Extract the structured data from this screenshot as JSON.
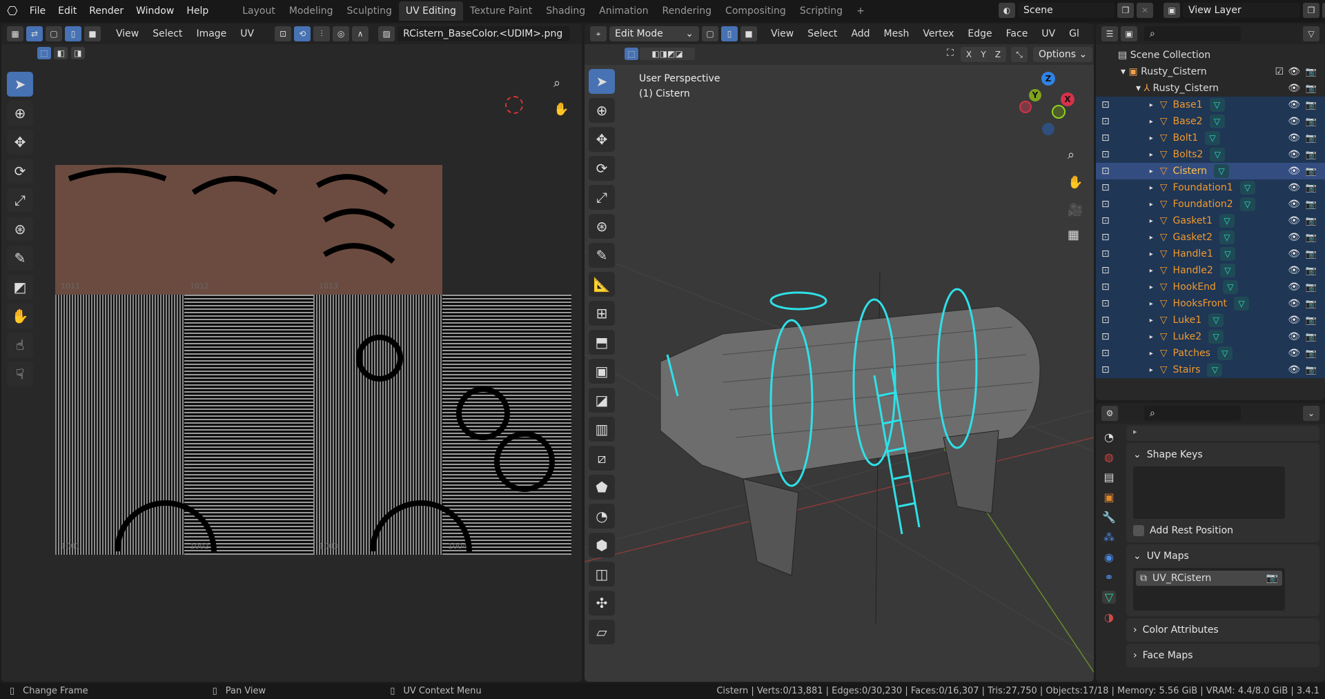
{
  "topbar": {
    "menus": [
      "File",
      "Edit",
      "Render",
      "Window",
      "Help"
    ],
    "workspaces": [
      "Layout",
      "Modeling",
      "Sculpting",
      "UV Editing",
      "Texture Paint",
      "Shading",
      "Animation",
      "Rendering",
      "Compositing",
      "Scripting"
    ],
    "active_workspace": "UV Editing",
    "add_tab": "+",
    "scene": "Scene",
    "view_layer": "View Layer"
  },
  "uv_editor": {
    "menus": [
      "View",
      "Select",
      "Image",
      "UV"
    ],
    "image_name": "RCistern_BaseColor.<UDIM>.png",
    "tiles_top": [
      "1011",
      "1012",
      "1013"
    ],
    "tiles_bottom": [
      "1001",
      "1002",
      "1003",
      "1004"
    ]
  },
  "viewport": {
    "mode": "Edit Mode",
    "menus": [
      "View",
      "Select",
      "Add",
      "Mesh",
      "Vertex",
      "Edge",
      "Face",
      "UV"
    ],
    "transform_orientation": "Gl",
    "axes": [
      "X",
      "Y",
      "Z"
    ],
    "options": "Options",
    "view_name": "User Perspective",
    "object_label": "(1) Cistern",
    "gizmo": {
      "x": "X",
      "y": "Y",
      "z": "Z"
    }
  },
  "outliner": {
    "root": "Scene Collection",
    "collection": "Rusty_Cistern",
    "empty": "Rusty_Cistern",
    "objects": [
      "Base1",
      "Base2",
      "Bolt1",
      "Bolts2",
      "Cistern",
      "Foundation1",
      "Foundation2",
      "Gasket1",
      "Gasket2",
      "Handle1",
      "Handle2",
      "HookEnd",
      "HooksFront",
      "Luke1",
      "Luke2",
      "Patches",
      "Stairs"
    ],
    "active": "Cistern"
  },
  "properties": {
    "shape_keys": "Shape Keys",
    "add_rest_position": "Add Rest Position",
    "add_rest_checked": false,
    "uv_maps": "UV Maps",
    "uv_map_item": "UV_RCistern",
    "color_attributes": "Color Attributes",
    "face_maps": "Face Maps"
  },
  "statusbar": {
    "left": [
      "Change Frame",
      "Pan View",
      "UV Context Menu"
    ],
    "stats": "Cistern | Verts:0/13,881 | Edges:0/30,230 | Faces:0/16,307 | Tris:27,750 | Objects:17/18 | Memory: 5.56 GiB | VRAM: 4.4/8.0 GiB | 3.4.1"
  },
  "colors": {
    "accent": "#4772b3",
    "object_orange": "#f19a2e",
    "selection_cyan": "#2fe0e8",
    "selected_row": "#1f3655"
  }
}
